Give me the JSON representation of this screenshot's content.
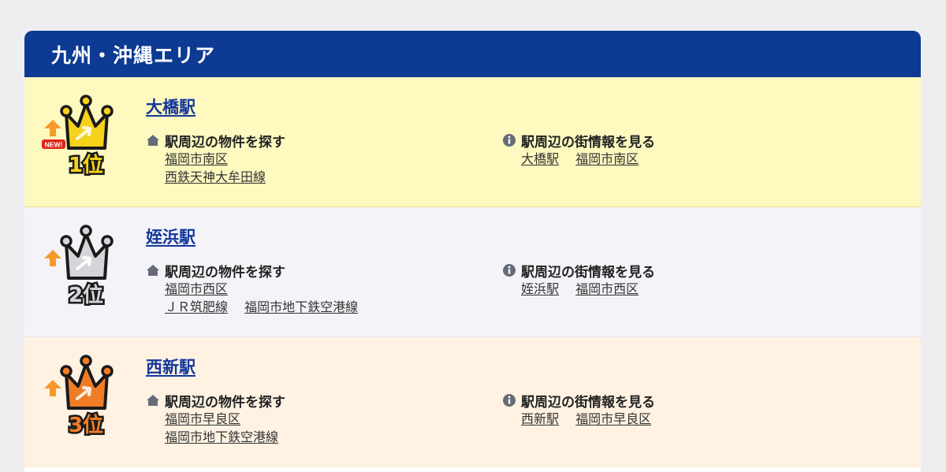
{
  "header": {
    "title": "九州・沖縄エリア"
  },
  "labels": {
    "search_properties": "駅周辺の物件を探す",
    "town_info": "駅周辺の街情報を見る"
  },
  "rankings": [
    {
      "rank_label": "1位",
      "new_badge": "NEW!",
      "trend": "up",
      "station": "大橋駅",
      "property_lines": [
        [
          "福岡市南区"
        ],
        [
          "西鉄天神大牟田線"
        ]
      ],
      "info_links": [
        "大橋駅",
        "福岡市南区"
      ],
      "crown_color": "#f7d21a"
    },
    {
      "rank_label": "2位",
      "trend": "up",
      "station": "姪浜駅",
      "property_lines": [
        [
          "福岡市西区"
        ],
        [
          "ＪＲ筑肥線",
          "福岡市地下鉄空港線"
        ]
      ],
      "info_links": [
        "姪浜駅",
        "福岡市西区"
      ],
      "crown_color": "#d5d4d8"
    },
    {
      "rank_label": "3位",
      "trend": "up",
      "station": "西新駅",
      "property_lines": [
        [
          "福岡市早良区"
        ],
        [
          "福岡市地下鉄空港線"
        ]
      ],
      "info_links": [
        "西新駅",
        "福岡市早良区"
      ],
      "crown_color": "#f07d25"
    }
  ],
  "colors": {
    "header_bg": "#0d3a93",
    "link": "#13389c",
    "trend_up": "#f59a2a"
  },
  "icons": {
    "house": "house-icon",
    "info": "info-icon",
    "trend": "arrow-up-icon",
    "crown": "crown-icon"
  }
}
